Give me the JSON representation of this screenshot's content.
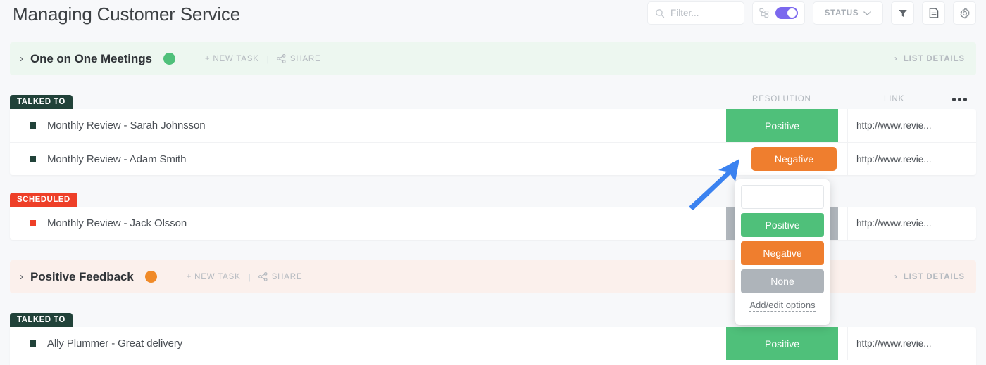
{
  "header": {
    "title": "Managing Customer Service",
    "search": {
      "placeholder": "Filter...",
      "value": "",
      "icon": "search-icon"
    },
    "subtask_toggle": {
      "icon": "hierarchy-icon",
      "state": "on",
      "color": "#7b68ee"
    },
    "status_dropdown": {
      "label": "STATUS",
      "icon": "chevron-down-icon"
    },
    "filter_button": {
      "icon": "funnel-icon"
    },
    "save_button": {
      "icon": "document-icon"
    },
    "settings_button": {
      "icon": "gear-icon"
    }
  },
  "columns": {
    "resolution": "RESOLUTION",
    "link": "LINK",
    "more": "more-options-icon"
  },
  "common": {
    "new_task": "+ NEW TASK",
    "share": "SHARE",
    "separator": "|",
    "list_details": "LIST DETAILS",
    "caret": "›"
  },
  "colors": {
    "positive": "#4fc07a",
    "negative": "#ef7e2e",
    "none": "#aeb4ba",
    "talked_to": "#214239",
    "scheduled": "#ee3f28",
    "accent_purple": "#7b68ee",
    "arrow_blue": "#3b82f0",
    "section_green_bg": "#edf7f0",
    "section_peach_bg": "#fbf0ec"
  },
  "sections": [
    {
      "name": "One on One Meetings",
      "dot_color": "#4fc07a",
      "bg": "#edf7f0",
      "groups": [
        {
          "tag": "TALKED TO",
          "tag_color": "#214239",
          "rows": [
            {
              "title": "Monthly Review - Sarah Johnsson",
              "square_color": "#214239",
              "resolution": "Positive",
              "resolution_color": "#4fc07a",
              "resolution_shape": "square",
              "link": "http://www.revie..."
            },
            {
              "title": "Monthly Review - Adam Smith",
              "square_color": "#214239",
              "resolution": "Negative",
              "resolution_color": "#ef7e2e",
              "resolution_shape": "rounded",
              "link": "http://www.revie..."
            }
          ]
        },
        {
          "tag": "SCHEDULED",
          "tag_color": "#ee3f28",
          "rows": [
            {
              "title": "Monthly Review - Jack Olsson",
              "square_color": "#ee3f28",
              "resolution": "",
              "resolution_color": "#b1b7bd",
              "resolution_shape": "square",
              "link": "http://www.revie..."
            }
          ]
        }
      ]
    },
    {
      "name": "Positive Feedback",
      "dot_color": "#f08a28",
      "bg": "#fbf0ec",
      "groups": [
        {
          "tag": "TALKED TO",
          "tag_color": "#214239",
          "rows": [
            {
              "title": "Ally Plummer - Great delivery",
              "square_color": "#214239",
              "resolution": "Positive",
              "resolution_color": "#4fc07a",
              "resolution_shape": "square",
              "link": "http://www.revie..."
            }
          ]
        }
      ]
    }
  ],
  "dropdown": {
    "blank_label": "–",
    "options": [
      {
        "label": "Positive",
        "color": "#4fc07a"
      },
      {
        "label": "Negative",
        "color": "#ef7e2e"
      },
      {
        "label": "None",
        "color": "#aeb4ba"
      }
    ],
    "footer_link": "Add/edit options"
  },
  "annotation": {
    "type": "arrow",
    "color": "#3b82f0",
    "points_to": "negative-resolution-pill"
  }
}
